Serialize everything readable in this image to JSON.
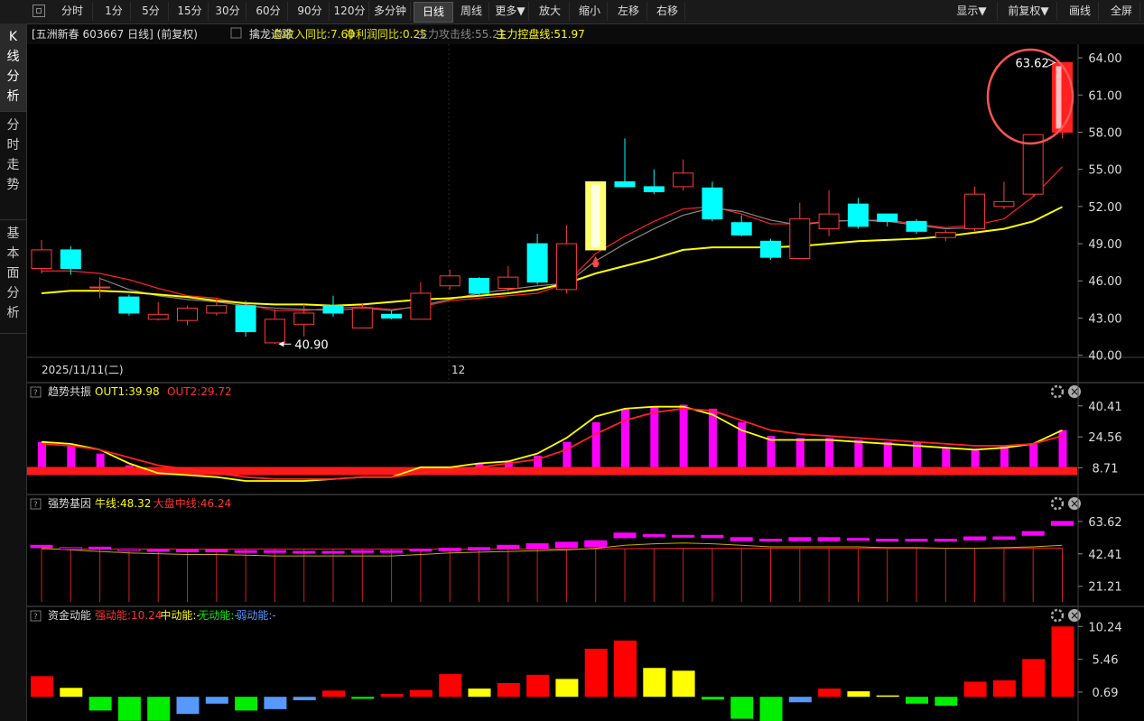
{
  "toolbar": {
    "periods": [
      "分时",
      "1分",
      "5分",
      "15分",
      "30分",
      "60分",
      "90分",
      "120分",
      "多分钟",
      "日线",
      "周线",
      "更多▼",
      "放大",
      "缩小",
      "左移",
      "右移"
    ],
    "active": "日线",
    "right": [
      "显示▼",
      "前复权▼",
      "画线",
      "全屏"
    ]
  },
  "sidebar": {
    "tabs": [
      {
        "label": [
          "K",
          "线",
          "分",
          "析"
        ],
        "active": true
      },
      {
        "label": [
          "分",
          "时",
          "走",
          "势"
        ],
        "active": false
      },
      {
        "label": [
          "基",
          "本",
          "面",
          "分",
          "析"
        ],
        "active": false
      }
    ]
  },
  "main_panel": {
    "stock": "[五洲新春 603667 日线]",
    "adjust": "(前复权)",
    "indicator_name": "擒龙追踪",
    "fields": [
      {
        "text": "总收入同比:7.60",
        "color": "#e6e600"
      },
      {
        "text": "净利润同比:0.25",
        "color": "#e6e600"
      },
      {
        "text": "主力攻击线:55.21",
        "color": "#888888"
      },
      {
        "text": "主力控盘线:51.97",
        "color": "#ffff00"
      }
    ],
    "date_label": "2025/11/11(二)",
    "month_label": "12",
    "low_label": "40.90",
    "high_label": "63.62"
  },
  "panels": [
    {
      "name": "趋势共振",
      "fields": [
        {
          "text": "OUT1:39.98",
          "color": "#ffff00"
        },
        {
          "text": "OUT2:29.72",
          "color": "#ff3333"
        }
      ]
    },
    {
      "name": "强势基因",
      "fields": [
        {
          "text": "牛线:48.32",
          "color": "#ffff00"
        },
        {
          "text": "大盘中线:46.24",
          "color": "#ff3333"
        }
      ]
    },
    {
      "name": "资金动能",
      "fields": [
        {
          "text": "强动能:10.24",
          "color": "#ff3333"
        },
        {
          "text": "中动能:-",
          "color": "#ffff00"
        },
        {
          "text": "无动能:-",
          "color": "#00ee00"
        },
        {
          "text": "弱动能:-",
          "color": "#5599ff"
        }
      ]
    }
  ],
  "chart_data": [
    {
      "type": "candlestick",
      "title": "五洲新春 603667 日线",
      "y_ticks": [
        "64.00",
        "61.00",
        "58.00",
        "55.00",
        "52.00",
        "49.00",
        "46.00",
        "43.00",
        "40.00"
      ],
      "ylim": [
        39.9,
        65.1
      ],
      "candles": [
        {
          "o": 47.0,
          "c": 48.5,
          "h": 49.3,
          "l": 46.6
        },
        {
          "o": 48.5,
          "c": 47.0,
          "h": 48.8,
          "l": 46.5
        },
        {
          "o": 45.5,
          "c": 45.5,
          "h": 46.3,
          "l": 44.6
        },
        {
          "o": 44.7,
          "c": 43.4,
          "h": 44.9,
          "l": 43.2
        },
        {
          "o": 42.9,
          "c": 43.3,
          "h": 44.3,
          "l": 42.8
        },
        {
          "o": 42.8,
          "c": 43.8,
          "h": 44.0,
          "l": 42.4
        },
        {
          "o": 43.4,
          "c": 44.0,
          "h": 44.6,
          "l": 43.2
        },
        {
          "o": 44.0,
          "c": 41.9,
          "h": 44.4,
          "l": 41.5
        },
        {
          "o": 41.0,
          "c": 42.9,
          "h": 43.7,
          "l": 40.9
        },
        {
          "o": 42.5,
          "c": 43.4,
          "h": 44.1,
          "l": 41.5
        },
        {
          "o": 44.0,
          "c": 43.4,
          "h": 44.8,
          "l": 43.1
        },
        {
          "o": 42.2,
          "c": 43.8,
          "h": 44.2,
          "l": 42.2
        },
        {
          "o": 43.3,
          "c": 43.0,
          "h": 43.6,
          "l": 42.9
        },
        {
          "o": 42.9,
          "c": 45.0,
          "h": 45.9,
          "l": 42.9
        },
        {
          "o": 45.6,
          "c": 46.4,
          "h": 46.9,
          "l": 45.3
        },
        {
          "o": 46.2,
          "c": 45.0,
          "h": 46.3,
          "l": 44.8
        },
        {
          "o": 45.4,
          "c": 46.3,
          "h": 47.2,
          "l": 45.1
        },
        {
          "o": 49.0,
          "c": 45.9,
          "h": 49.8,
          "l": 45.7
        },
        {
          "o": 45.3,
          "c": 49.0,
          "h": 50.5,
          "l": 45.0
        },
        {
          "o": 48.5,
          "c": 54.0,
          "h": 54.0,
          "l": 48.5
        },
        {
          "o": 54.0,
          "c": 53.6,
          "h": 57.5,
          "l": 53.6
        },
        {
          "o": 53.6,
          "c": 53.2,
          "h": 55.0,
          "l": 53.0
        },
        {
          "o": 53.6,
          "c": 54.7,
          "h": 55.8,
          "l": 53.3
        },
        {
          "o": 53.5,
          "c": 51.0,
          "h": 54.0,
          "l": 50.8
        },
        {
          "o": 50.7,
          "c": 49.7,
          "h": 51.3,
          "l": 49.6
        },
        {
          "o": 49.2,
          "c": 47.9,
          "h": 49.4,
          "l": 47.7
        },
        {
          "o": 47.8,
          "c": 51.0,
          "h": 52.3,
          "l": 47.8
        },
        {
          "o": 50.2,
          "c": 51.4,
          "h": 53.3,
          "l": 49.6
        },
        {
          "o": 52.2,
          "c": 50.4,
          "h": 52.7,
          "l": 50.2
        },
        {
          "o": 51.4,
          "c": 50.8,
          "h": 51.4,
          "l": 50.4
        },
        {
          "o": 50.8,
          "c": 50.0,
          "h": 51.0,
          "l": 49.8
        },
        {
          "o": 49.5,
          "c": 49.9,
          "h": 50.1,
          "l": 49.2
        },
        {
          "o": 50.2,
          "c": 53.0,
          "h": 53.6,
          "l": 50.0
        },
        {
          "o": 52.0,
          "c": 52.4,
          "h": 54.0,
          "l": 51.8
        },
        {
          "o": 53.0,
          "c": 57.8,
          "h": 57.8,
          "l": 52.8
        },
        {
          "o": 58.0,
          "c": 63.62,
          "h": 63.62,
          "l": 57.5
        }
      ],
      "highlight_candles": [
        19,
        35
      ],
      "series": [
        {
          "name": "主力攻击线",
          "color_line": "#ff2222",
          "values": [
            46.8,
            46.8,
            46.6,
            46.1,
            45.4,
            44.8,
            44.6,
            44.1,
            43.6,
            43.6,
            43.8,
            43.9,
            43.7,
            43.9,
            44.4,
            44.6,
            44.8,
            45.0,
            45.8,
            48.2,
            49.6,
            50.8,
            51.8,
            52.0,
            51.4,
            50.6,
            50.6,
            50.8,
            50.9,
            50.9,
            50.6,
            50.3,
            50.5,
            51.0,
            52.8,
            55.21
          ]
        },
        {
          "name": "",
          "color_line": "#888888",
          "values": [
            null,
            null,
            46.2,
            45.3,
            44.8,
            44.5,
            44.3,
            44.0,
            43.8,
            43.7,
            43.6,
            43.8,
            43.6,
            44.0,
            44.5,
            45.0,
            45.3,
            45.6,
            45.8,
            47.6,
            49.0,
            50.2,
            51.3,
            51.9,
            51.6,
            50.9,
            50.5,
            50.8,
            50.9,
            50.8,
            50.5,
            50.2,
            50.3,
            null,
            null,
            null
          ]
        },
        {
          "name": "主力控盘线",
          "color_line": "#ffff00",
          "values": [
            45.0,
            45.2,
            45.2,
            45.1,
            44.9,
            44.7,
            44.4,
            44.2,
            44.1,
            44.1,
            44.0,
            44.1,
            44.3,
            44.5,
            44.6,
            44.8,
            45.0,
            45.3,
            45.8,
            46.6,
            47.2,
            47.8,
            48.5,
            48.7,
            48.7,
            48.7,
            48.8,
            49.0,
            49.2,
            49.3,
            49.4,
            49.6,
            49.9,
            50.2,
            50.8,
            51.97
          ]
        }
      ]
    },
    {
      "type": "bar",
      "title": "趋势共振",
      "y_ticks": [
        "40.41",
        "24.56",
        "8.71"
      ],
      "ylim": [
        2.0,
        44.0
      ],
      "values": [
        22.0,
        20.0,
        16.0,
        10.0,
        5.0,
        5.0,
        4.0,
        2.0,
        2.0,
        2.0,
        3.0,
        4.0,
        4.0,
        8.0,
        9.0,
        11.0,
        12.0,
        15.0,
        22.0,
        32.0,
        39.0,
        40.0,
        41.0,
        39.0,
        32.0,
        25.0,
        24.0,
        24.0,
        23.0,
        22.0,
        22.0,
        19.0,
        18.0,
        20.0,
        21.0,
        28.0,
        39.98
      ],
      "series": [
        {
          "name": "OUT1",
          "values": [
            22,
            21,
            18,
            11,
            6,
            5,
            4,
            1,
            1,
            2,
            3,
            4,
            4,
            9,
            9,
            11,
            12,
            16,
            24,
            35,
            39,
            40,
            40,
            36,
            28,
            23,
            23,
            23,
            22,
            21,
            20,
            19,
            18,
            19,
            21,
            28,
            39.98
          ]
        },
        {
          "name": "OUT2",
          "values": [
            21,
            20,
            18,
            14,
            10,
            8,
            6,
            4,
            3,
            3,
            3,
            4,
            4,
            6,
            8,
            9,
            11,
            13,
            18,
            26,
            33,
            37,
            39,
            38,
            33,
            28,
            26,
            25,
            24,
            23,
            22,
            21,
            20,
            20,
            21,
            25,
            29.72
          ]
        }
      ],
      "baseline": 8.71
    },
    {
      "type": "bar",
      "title": "强势基因",
      "y_ticks": [
        "63.62",
        "42.41",
        "21.21"
      ],
      "ylim": [
        11.0,
        70.0
      ],
      "series": [
        {
          "name": "牛线",
          "values": [
            48.0,
            47.0,
            46.0,
            45.0,
            44.5,
            44.0,
            44.0,
            43.5,
            43.0,
            43.0,
            43.0,
            43.0,
            43.0,
            44.0,
            45.0,
            45.5,
            46.0,
            46.5,
            47.0,
            48.0,
            50.0,
            51.0,
            51.5,
            51.0,
            50.0,
            49.0,
            49.0,
            49.0,
            49.0,
            48.5,
            48.5,
            48.0,
            48.0,
            48.5,
            49.0,
            50.0,
            48.32
          ]
        },
        {
          "name": "大盘中线",
          "values": [
            45.6,
            45.6,
            45.6,
            45.6,
            45.6,
            45.6,
            45.6,
            45.6,
            45.6,
            45.6,
            45.6,
            45.6,
            45.6,
            45.6,
            45.6,
            45.6,
            45.6,
            45.6,
            45.6,
            45.6,
            45.8,
            45.9,
            46.0,
            46.0,
            46.0,
            46.0,
            46.0,
            46.0,
            46.0,
            46.1,
            46.1,
            46.1,
            46.1,
            46.1,
            46.2,
            46.2,
            46.24
          ]
        }
      ],
      "bars": [
        {
          "o": 46.5,
          "c": 48.0
        },
        {
          "o": 46.5,
          "c": 46.0
        },
        {
          "o": 45.5,
          "c": 46.8
        },
        {
          "o": 45.5,
          "c": 44.8
        },
        {
          "o": 45.0,
          "c": 45.2
        },
        {
          "o": 44.5,
          "c": 45.0
        },
        {
          "o": 44.5,
          "c": 45.0
        },
        {
          "o": 43.5,
          "c": 44.5
        },
        {
          "o": 43.5,
          "c": 44.5
        },
        {
          "o": 43.5,
          "c": 44.0
        },
        {
          "o": 43.5,
          "c": 44.0
        },
        {
          "o": 43.5,
          "c": 44.5
        },
        {
          "o": 43.5,
          "c": 44.5
        },
        {
          "o": 44.5,
          "c": 45.5
        },
        {
          "o": 44.5,
          "c": 46.0
        },
        {
          "o": 45.0,
          "c": 46.5
        },
        {
          "o": 46.0,
          "c": 48.0
        },
        {
          "o": 46.0,
          "c": 49.0
        },
        {
          "o": 46.5,
          "c": 50.0
        },
        {
          "o": 47.0,
          "c": 51.0
        },
        {
          "o": 53.0,
          "c": 56.0
        },
        {
          "o": 54.0,
          "c": 55.0
        },
        {
          "o": 53.5,
          "c": 54.5
        },
        {
          "o": 53.0,
          "c": 54.5
        },
        {
          "o": 51.0,
          "c": 53.0
        },
        {
          "o": 51.0,
          "c": 52.0
        },
        {
          "o": 51.0,
          "c": 53.0
        },
        {
          "o": 51.0,
          "c": 53.0
        },
        {
          "o": 51.5,
          "c": 52.5
        },
        {
          "o": 51.0,
          "c": 52.0
        },
        {
          "o": 51.0,
          "c": 52.0
        },
        {
          "o": 51.0,
          "c": 52.0
        },
        {
          "o": 51.5,
          "c": 53.5
        },
        {
          "o": 52.0,
          "c": 53.5
        },
        {
          "o": 54.5,
          "c": 57.0
        },
        {
          "o": 61.0,
          "c": 63.62
        }
      ]
    },
    {
      "type": "bar",
      "title": "资金动能",
      "y_ticks": [
        "10.24",
        "5.46",
        "0.69"
      ],
      "ylim": [
        -3.0,
        10.8
      ],
      "values": [
        3.0,
        1.3,
        -2.0,
        -3.5,
        -3.5,
        -2.5,
        -1.0,
        -2.0,
        -1.8,
        -0.5,
        0.9,
        -0.3,
        0.4,
        1.0,
        3.3,
        1.2,
        2.0,
        3.2,
        2.6,
        7.0,
        8.2,
        4.2,
        3.8,
        -0.4,
        -3.2,
        -4.0,
        -0.8,
        1.2,
        0.8,
        0.2,
        -1.0,
        -1.3,
        2.2,
        2.4,
        5.5,
        10.24
      ],
      "colors": [
        "red",
        "yellow",
        "green",
        "green",
        "green",
        "blue",
        "blue",
        "green",
        "blue",
        "blue",
        "red",
        "green",
        "red",
        "red",
        "red",
        "yellow",
        "red",
        "red",
        "yellow",
        "red",
        "red",
        "yellow",
        "yellow",
        "green",
        "green",
        "green",
        "blue",
        "red",
        "yellow",
        "yellow",
        "green",
        "green",
        "red",
        "red",
        "red",
        "red"
      ]
    }
  ]
}
